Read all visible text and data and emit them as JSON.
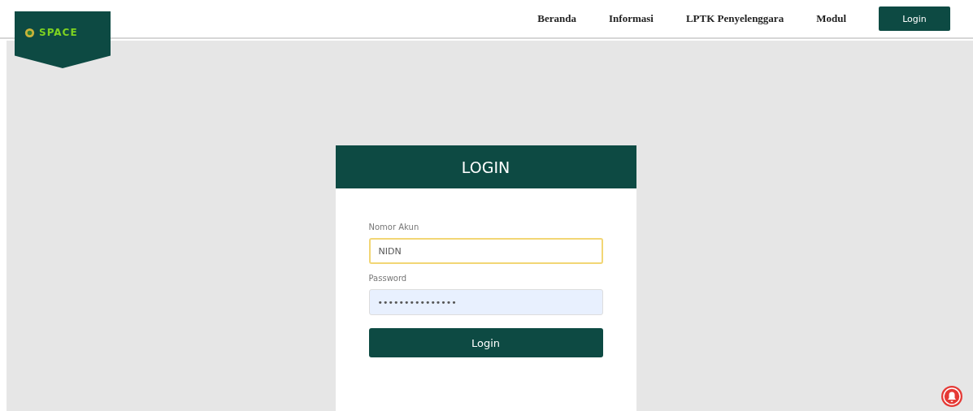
{
  "logo": {
    "text": "SPACE"
  },
  "nav": [
    {
      "label": "Beranda",
      "kind": "link"
    },
    {
      "label": "Informasi",
      "kind": "link"
    },
    {
      "label": "LPTK Penyelenggara",
      "kind": "link"
    },
    {
      "label": "Modul",
      "kind": "link"
    },
    {
      "label": "Login",
      "kind": "button"
    }
  ],
  "login_card": {
    "title": "LOGIN",
    "fields": [
      {
        "label": "Nomor Akun",
        "value": "NIDN",
        "focused": true
      },
      {
        "label": "Password",
        "value": "•••••••••••••••",
        "focused": false
      }
    ],
    "submit": "Login"
  }
}
